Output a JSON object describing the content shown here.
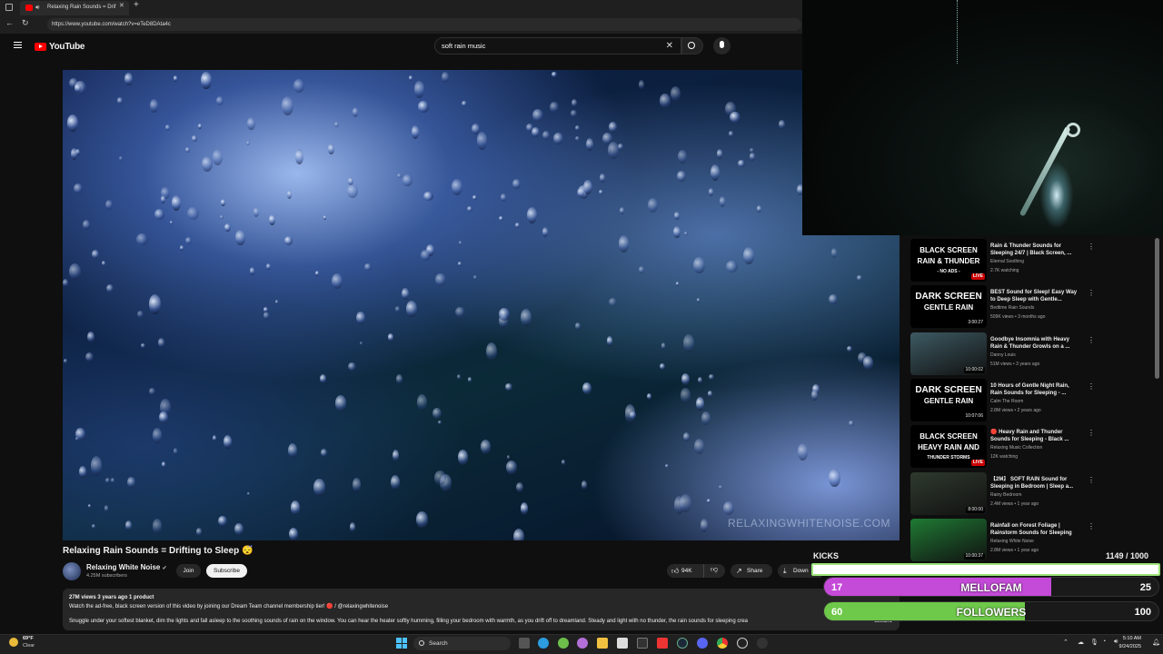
{
  "browser": {
    "tab_title": "Relaxing Rain Sounds = Drif",
    "url": "https://www.youtube.com/watch?v=eTeD8DAta4c"
  },
  "youtube": {
    "logo_text": "YouTube",
    "search_value": "soft rain music"
  },
  "video": {
    "watermark": "RELAXINGWHITENOISE.COM",
    "title": "Relaxing Rain Sounds = Drifting to Sleep 😴",
    "channel": "Relaxing White Noise",
    "subscribers": "4.25M subscribers",
    "join_label": "Join",
    "subscribe_label": "Subscribe",
    "likes": "94K",
    "share_label": "Share",
    "download_label": "Down"
  },
  "description": {
    "meta": "27M views  3 years ago  1 product",
    "line1": "Watch the ad-free, black screen version of this video by joining our Dream Team channel membership tier! 🔴 / @relaxingwhitenoise",
    "line2": "Snuggle under your softest blanket, dim the lights and fall asleep to the soothing sounds of rain on the window. You can hear the heater softly humming, filling your bedroom with warmth, as you drift off to dreamland. Steady and light with no thunder, the rain sounds for sleeping crea",
    "more_label": "...more"
  },
  "sidebar": {
    "items": [
      {
        "thumb_top": "BLACK SCREEN",
        "thumb_mid": "RAIN & THUNDER",
        "thumb_sub": "- NO ADS -",
        "badge": "LIVE",
        "thumb_bg": "#000000",
        "title": "Rain & Thunder Sounds for Sleeping 24/7 | Black Screen, ...",
        "channel": "Eternal Soothing",
        "views": "2.7K watching"
      },
      {
        "thumb_top": "DARK SCREEN",
        "thumb_mid": "GENTLE RAIN",
        "thumb_sub": "",
        "badge": "3:00:27",
        "thumb_bg": "#000000",
        "title": "BEST Sound for Sleep! Easy Way to Deep Sleep with Gentle...",
        "channel": "Bedtime Rain Sounds",
        "views": "509K views • 3 months ago"
      },
      {
        "thumb_top": "",
        "thumb_mid": "",
        "thumb_sub": "",
        "badge": "10:00:02",
        "thumb_bg": "#3d5a63",
        "title": "Goodbye Insomnia with Heavy Rain & Thunder Growls on a ...",
        "channel": "Danny Louis",
        "views": "51M views • 3 years ago"
      },
      {
        "thumb_top": "DARK SCREEN",
        "thumb_mid": "GENTLE RAIN",
        "thumb_sub": "",
        "badge": "10:07:06",
        "thumb_bg": "#000000",
        "title": "10 Hours of Gentle Night Rain, Rain Sounds for Sleeping - ...",
        "channel": "Calm The Room",
        "views": "2.8M views • 2 years ago"
      },
      {
        "thumb_top": "BLACK SCREEN",
        "thumb_mid": "HEAVY RAIN AND",
        "thumb_sub": "THUNDER STORMS",
        "badge": "LIVE",
        "thumb_bg": "#000000",
        "title": "🔴 Heavy Rain and Thunder Sounds for Sleeping - Black ...",
        "channel": "Relaxing Music Collection",
        "views": "12K watching"
      },
      {
        "thumb_top": "",
        "thumb_mid": "",
        "thumb_sub": "",
        "badge": "8:00:00",
        "thumb_bg": "#2f3a2e",
        "title": "【2M】 SOFT RAIN Sound for Sleeping in Bedroom | Sleep a...",
        "channel": "Rainy Bedroom",
        "views": "2.4M views • 1 year ago"
      },
      {
        "thumb_top": "",
        "thumb_mid": "",
        "thumb_sub": "",
        "badge": "10:00:37",
        "thumb_bg": "#1f7a34",
        "title": "Rainfall on Forest Foliage | Rainstorm Sounds for Sleeping",
        "channel": "Relaxing White Noise",
        "views": "2.8M views • 1 year ago"
      }
    ]
  },
  "overlay": {
    "kicks_label": "KICKS",
    "kicks_count": "1149 / 1000",
    "kicks_progress": 1.0,
    "kicks_fill_color": "#ffffff",
    "mellofam": {
      "left": "17",
      "label": "MELLOFAM",
      "right": "25",
      "progress": 0.68,
      "color": "#c44ad8"
    },
    "followers": {
      "left": "60",
      "label": "FOLLOWERS",
      "right": "100",
      "progress": 0.6,
      "color": "#6ec84a"
    }
  },
  "taskbar": {
    "weather_temp": "69°F",
    "weather_cond": "Clear",
    "search_label": "Search",
    "time": "5:10 AM",
    "date": "9/24/2025"
  }
}
